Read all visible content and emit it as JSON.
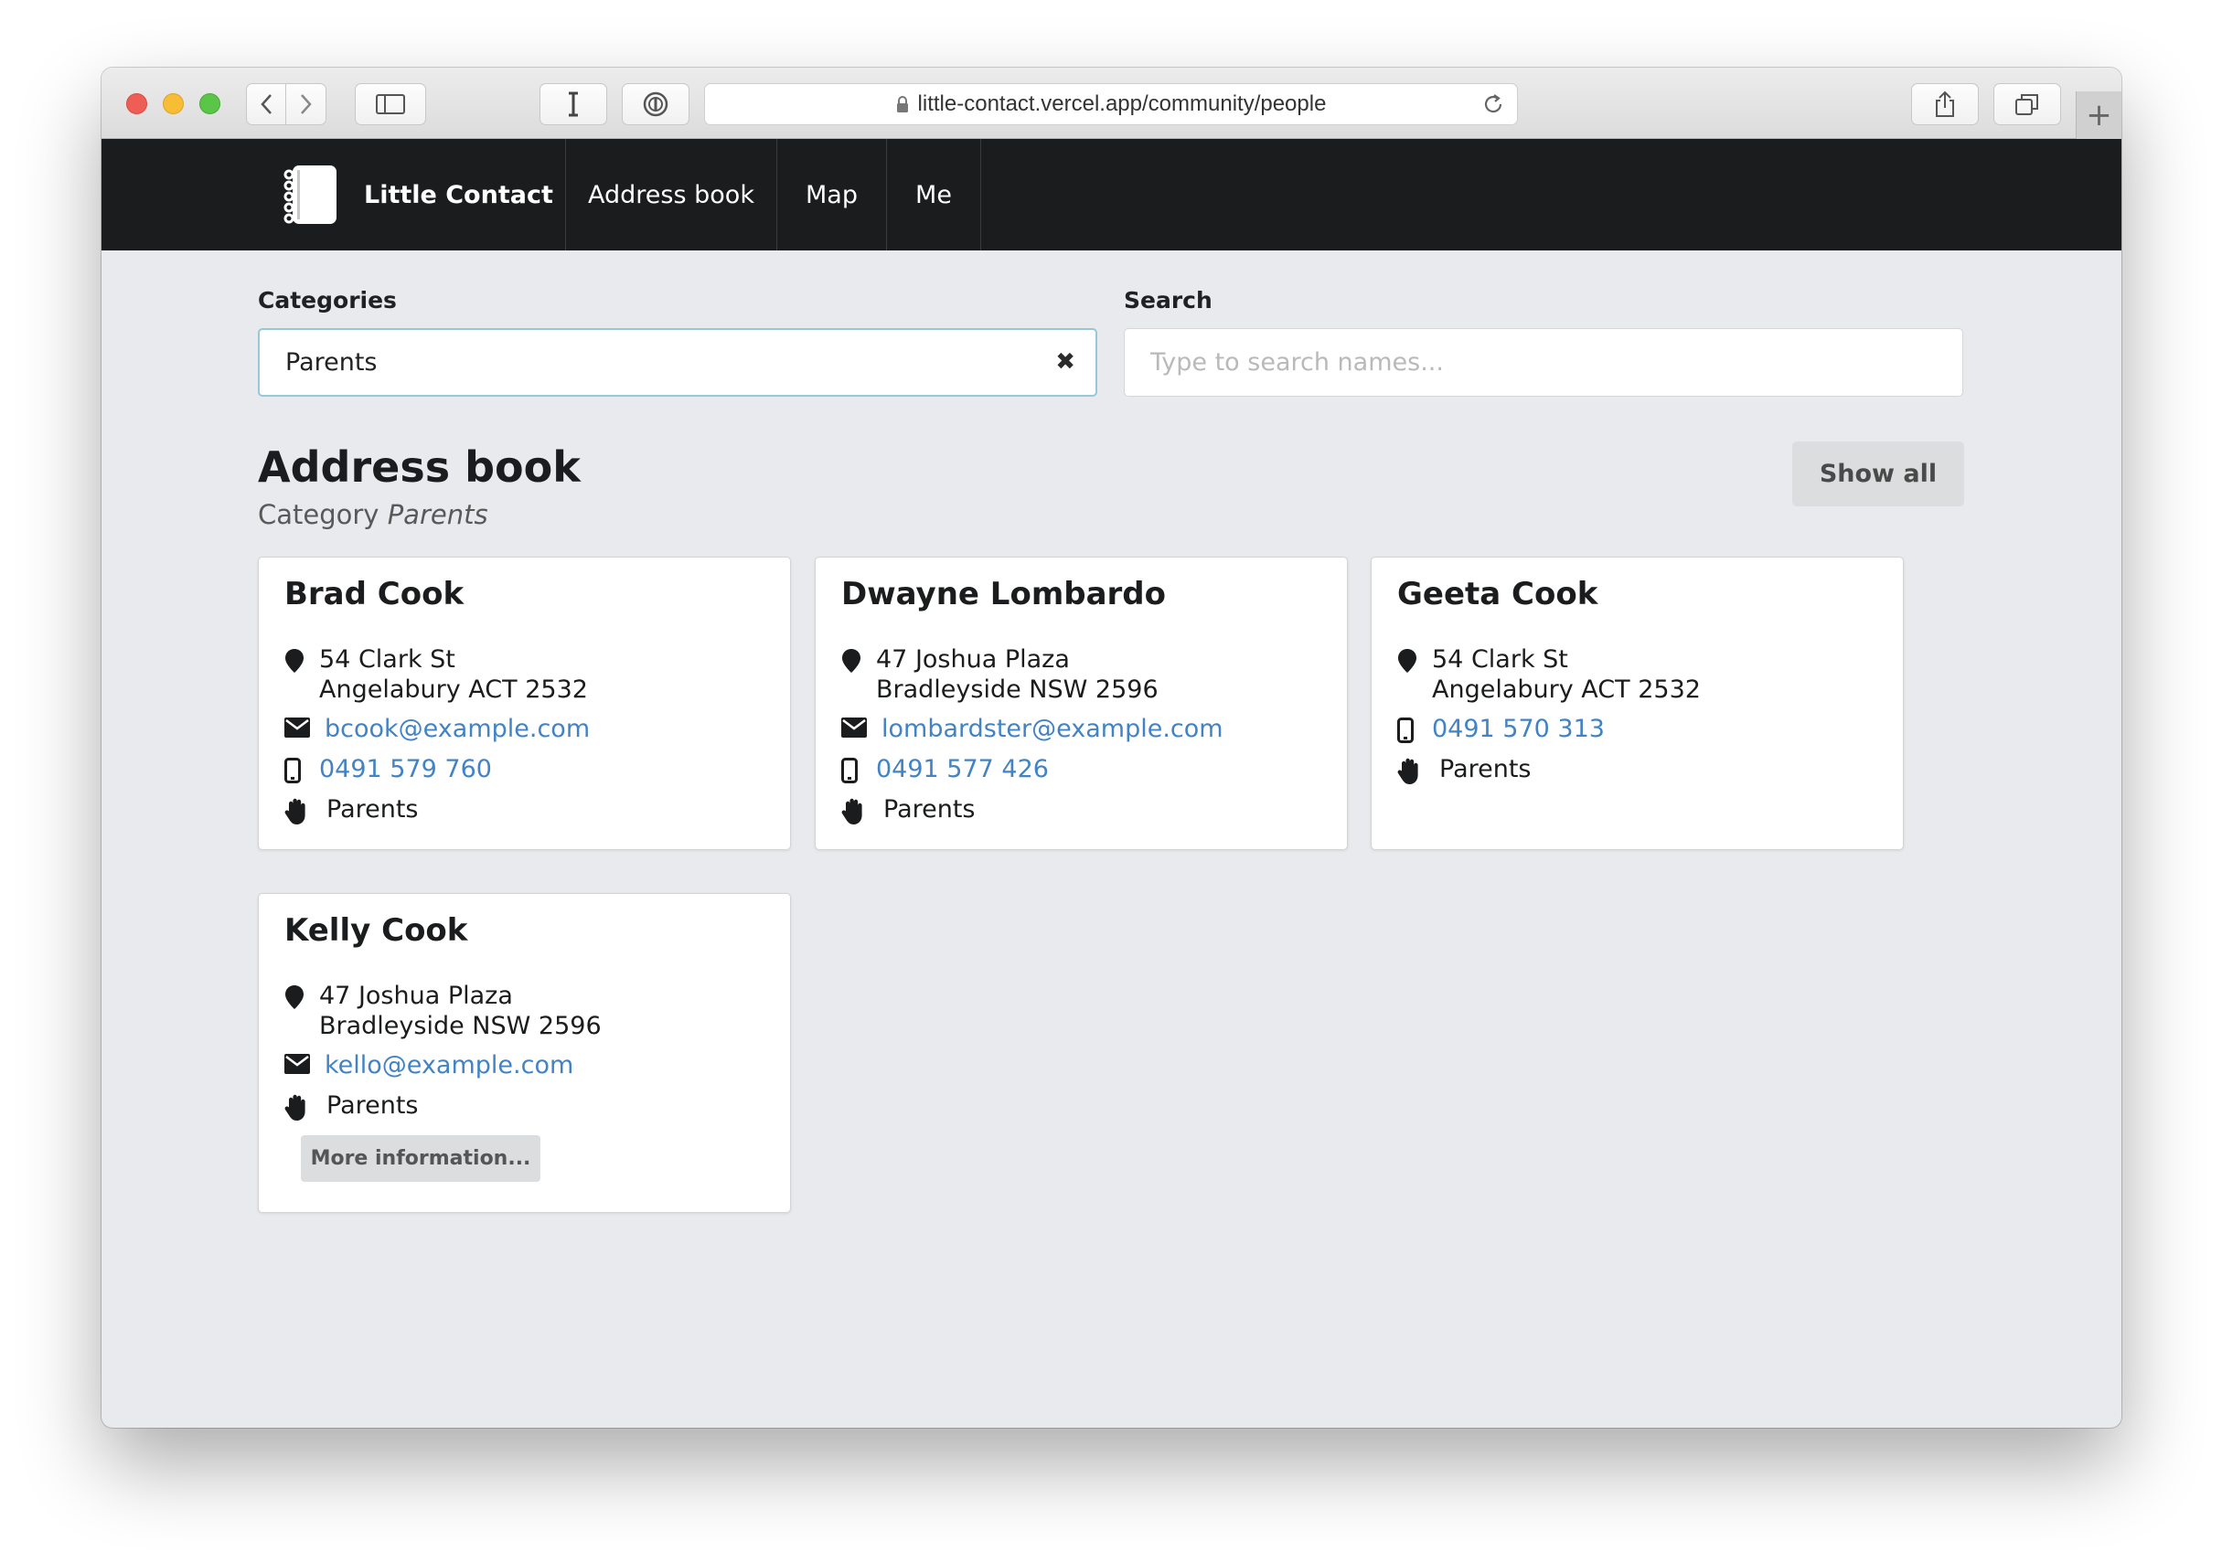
{
  "browser": {
    "url": "little-contact.vercel.app/community/people"
  },
  "navbar": {
    "brand": "Little Contact",
    "items": [
      "Address book",
      "Map",
      "Me"
    ]
  },
  "filters": {
    "categories_label": "Categories",
    "categories_value": "Parents",
    "search_label": "Search",
    "search_placeholder": "Type to search names..."
  },
  "heading": {
    "title": "Address book",
    "subtitle_prefix": "Category",
    "subtitle_category": "Parents",
    "show_all": "Show all"
  },
  "contacts": [
    {
      "name": "Brad Cook",
      "address_line1": "54 Clark St",
      "address_line2": "Angelabury ACT 2532",
      "email": "bcook@example.com",
      "phone": "0491 579 760",
      "category": "Parents"
    },
    {
      "name": "Dwayne Lombardo",
      "address_line1": "47 Joshua Plaza",
      "address_line2": "Bradleyside NSW 2596",
      "email": "lombardster@example.com",
      "phone": "0491 577 426",
      "category": "Parents"
    },
    {
      "name": "Geeta Cook",
      "address_line1": "54 Clark St",
      "address_line2": "Angelabury ACT 2532",
      "phone": "0491 570 313",
      "category": "Parents"
    },
    {
      "name": "Kelly Cook",
      "address_line1": "47 Joshua Plaza",
      "address_line2": "Bradleyside NSW 2596",
      "email": "kello@example.com",
      "category": "Parents",
      "more_label": "More information..."
    }
  ],
  "colors": {
    "navbar_bg": "#1b1c1d",
    "page_bg": "#e9eaed",
    "link": "#4183c4",
    "select_focus_border": "#96c8da"
  },
  "icons": {
    "address": "map-marker-icon",
    "email": "envelope-icon",
    "phone": "mobile-phone-icon",
    "category": "hand-icon"
  }
}
